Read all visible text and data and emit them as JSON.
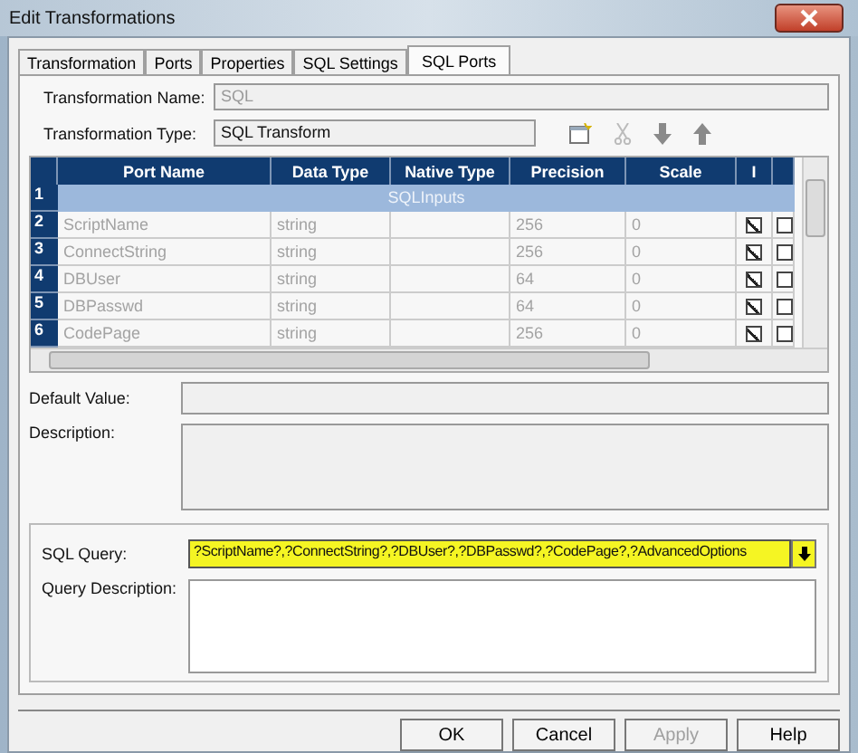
{
  "window": {
    "title": "Edit Transformations"
  },
  "tabs": [
    {
      "label": "Transformation",
      "selected": false
    },
    {
      "label": "Ports",
      "selected": false
    },
    {
      "label": "Properties",
      "selected": false
    },
    {
      "label": "SQL Settings",
      "selected": false
    },
    {
      "label": "SQL Ports",
      "selected": true
    }
  ],
  "transformation_name": {
    "label": "Transformation Name:",
    "value": "SQL",
    "disabled": true
  },
  "transformation_type": {
    "label": "Transformation Type:",
    "value": "SQL Transform"
  },
  "grid": {
    "columns": [
      "Port Name",
      "Data Type",
      "Native Type",
      "Precision",
      "Scale",
      "I"
    ],
    "rows": [
      {
        "number": "1",
        "kind": "group",
        "label": "SQLInputs"
      },
      {
        "number": "2",
        "kind": "port",
        "port_name": "ScriptName",
        "data_type": "string",
        "precision": "256",
        "scale": "0",
        "input": true,
        "column_7": false
      },
      {
        "number": "3",
        "kind": "port",
        "port_name": "ConnectString",
        "data_type": "string",
        "precision": "256",
        "scale": "0",
        "input": true,
        "column_7": false
      },
      {
        "number": "4",
        "kind": "port",
        "port_name": "DBUser",
        "data_type": "string",
        "precision": "64",
        "scale": "0",
        "input": true,
        "column_7": false
      },
      {
        "number": "5",
        "kind": "port",
        "port_name": "DBPasswd",
        "data_type": "string",
        "precision": "64",
        "scale": "0",
        "input": true,
        "column_7": false
      },
      {
        "number": "6",
        "kind": "port",
        "port_name": "CodePage",
        "data_type": "string",
        "precision": "256",
        "scale": "0",
        "input": true,
        "column_7": false
      }
    ]
  },
  "default_value": {
    "label": "Default Value:"
  },
  "description": {
    "label": "Description:"
  },
  "sql_query": {
    "label": "SQL Query:",
    "value": "?ScriptName?,?ConnectString?,?DBUser?,?DBPasswd?,?CodePage?,?AdvancedOptions",
    "highlighted": true
  },
  "query_description": {
    "label": "Query Description:"
  },
  "buttons": [
    {
      "label": "OK",
      "disabled": false
    },
    {
      "label": "Cancel",
      "disabled": false
    },
    {
      "label": "Apply",
      "disabled": true
    },
    {
      "label": "Help",
      "disabled": false
    }
  ]
}
